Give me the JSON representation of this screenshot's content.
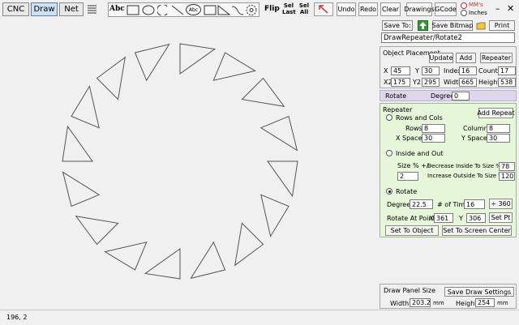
{
  "modes": {
    "cnc": "CNC",
    "draw": "Draw",
    "net": "Net"
  },
  "toolbar": {
    "abc_text_tool": "Abc",
    "abc_circle_tool": "Abc",
    "flip": "Flip",
    "sel_last": "Sel Last",
    "sel_all": "Sel All",
    "undo": "Undo",
    "redo": "Redo",
    "clear": "Clear",
    "drawings": "Drawings",
    "gcode": "GCode",
    "units_mm": "MM's",
    "units_inches": "Inches"
  },
  "panel": {
    "save_to": "Save To:",
    "save_bitmap": "Save Bitmap",
    "print": "Print",
    "drawing_name": "DrawRepeater/Rotate2",
    "object_placement": {
      "title": "Object Placement",
      "update": "Update",
      "add": "Add",
      "repeater": "Repeater",
      "x_label": "X",
      "x": "45",
      "y_label": "Y",
      "y": "30",
      "index_label": "Index",
      "index": "16",
      "count_label": "Count",
      "count": "17",
      "x2_label": "X2",
      "x2": "175",
      "y2_label": "Y2",
      "y2": "295",
      "width_label": "Width",
      "width": "665",
      "height_label": "Height",
      "height": "538"
    },
    "rotate_bar": {
      "label": "Rotate",
      "degrees_label": "Degrees",
      "degrees": "0"
    },
    "repeater": {
      "title": "Repeater",
      "add_repeat": "Add Repeat",
      "rows_cols_label": "Rows and Cols",
      "rows_label": "Rows",
      "rows": "8",
      "columns_label": "Columns",
      "columns": "8",
      "x_spacer_label": "X Spacer",
      "x_spacer": "30",
      "y_spacer_label": "Y Spacer",
      "y_spacer": "30",
      "inside_out_label": "Inside and Out",
      "size_label": "Size % +/-",
      "size": "2",
      "decrease_label": "Decrease Inside To Size %",
      "decrease": "78",
      "increase_label": "Increase Outside To Size %",
      "increase": "120",
      "rotate_label": "Rotate",
      "degrees_label": "Degrees",
      "degrees": "22.5",
      "times_label": "# of Times",
      "times": "16",
      "div360": "÷ 360",
      "rotate_point_label": "Rotate At Point",
      "px_label": "X",
      "px": "361",
      "py_label": "Y",
      "py": "306",
      "set_pt": "Set Pt",
      "set_to_object": "Set To Object",
      "set_to_center": "Set To Screen Center"
    },
    "draw_panel": {
      "title": "Draw Panel Size",
      "save_settings": "Save Draw Settings",
      "width_label": "Width",
      "width": "203.2",
      "width_unit": "mm",
      "height_label": "Height",
      "height": "254",
      "height_unit": "mm"
    }
  },
  "status": {
    "coords": "196, 2"
  },
  "drawing": {
    "count": 16,
    "step_degrees": 22.5,
    "stroke": "#555555"
  },
  "window_controls": {
    "minimize": "–",
    "close": "✕"
  }
}
